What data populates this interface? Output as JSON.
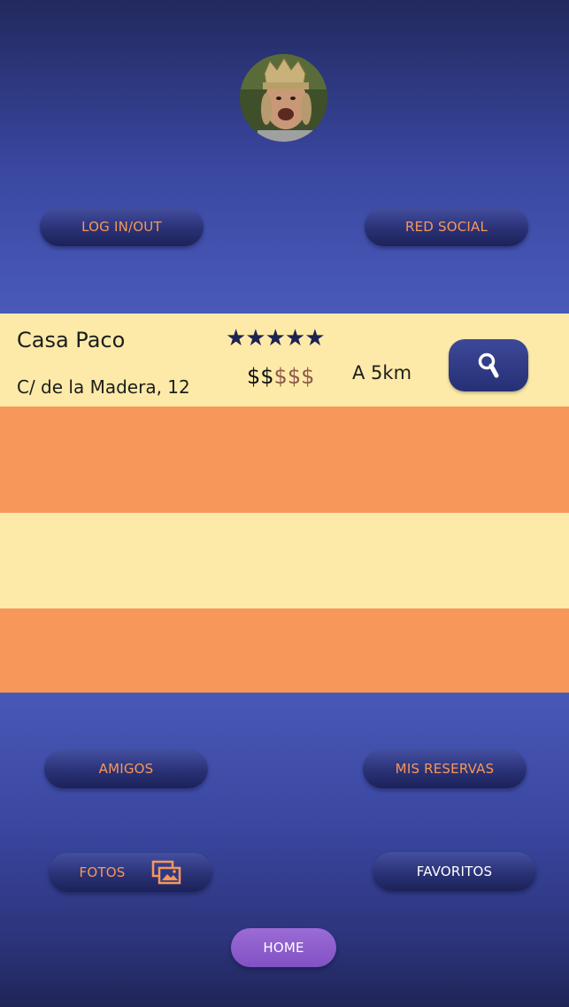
{
  "colors": {
    "accent_orange": "#f7975a",
    "band_cream": "#fdeaa8",
    "band_orange": "#f7975a",
    "navy": "#2a3276",
    "purple": "#8b5cc8"
  },
  "header": {
    "avatar_icon": "user-avatar-photo",
    "login_label": "LOG IN/OUT",
    "social_label": "RED SOCIAL"
  },
  "listing": {
    "name": "Casa Paco",
    "address": "C/ de la Madera, 12",
    "rating": 5,
    "rating_text": "★★★★★",
    "price_filled": "$$",
    "price_empty": "$$$",
    "distance": "A 5km",
    "search_icon": "search-icon"
  },
  "footer": {
    "friends_label": "AMIGOS",
    "bookings_label": "MIS RESERVAS",
    "photos_label": "FOTOS",
    "photos_icon": "gallery-icon",
    "favorites_label": "FAVORITOS",
    "home_label": "HOME"
  }
}
